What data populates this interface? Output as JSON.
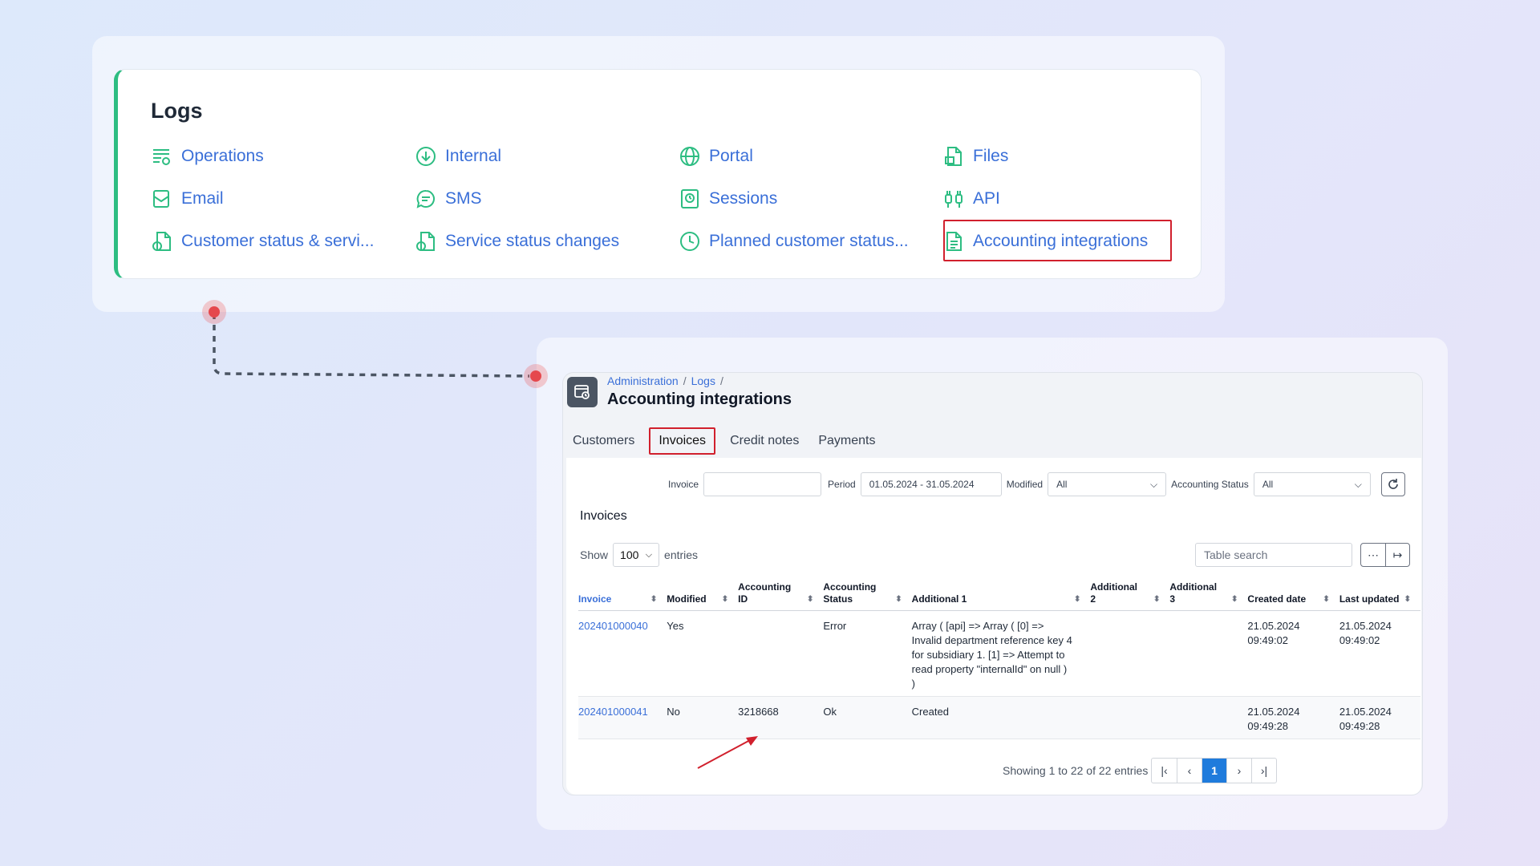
{
  "logs": {
    "title": "Logs",
    "items": [
      {
        "label": "Operations",
        "icon": "operations-icon"
      },
      {
        "label": "Internal",
        "icon": "download-circle-icon"
      },
      {
        "label": "Portal",
        "icon": "globe-icon"
      },
      {
        "label": "Files",
        "icon": "file-icon"
      },
      {
        "label": "Email",
        "icon": "email-icon"
      },
      {
        "label": "SMS",
        "icon": "chat-icon"
      },
      {
        "label": "Sessions",
        "icon": "sessions-icon"
      },
      {
        "label": "API",
        "icon": "api-icon"
      },
      {
        "label": "Customer status & servi...",
        "icon": "status-file-icon"
      },
      {
        "label": "Service status changes",
        "icon": "status-file-icon"
      },
      {
        "label": "Planned customer status...",
        "icon": "clock-icon"
      },
      {
        "label": "Accounting integrations",
        "icon": "document-icon"
      }
    ],
    "accent": "#2dbd82",
    "link_color": "#3a6fd8",
    "highlight_color": "#d1202d"
  },
  "accounting": {
    "breadcrumb": {
      "first": "Administration",
      "sep1": "/",
      "second": "Logs",
      "sep2": "/"
    },
    "title": "Accounting integrations",
    "tabs": [
      "Customers",
      "Invoices",
      "Credit notes",
      "Payments"
    ],
    "active_tab": "Invoices",
    "filters": {
      "invoice_label": "Invoice",
      "invoice_value": "",
      "period_label": "Period",
      "period_value": "01.05.2024 - 31.05.2024",
      "modified_label": "Modified",
      "modified_value": "All",
      "status_label": "Accounting Status",
      "status_value": "All"
    },
    "section_title": "Invoices",
    "show_label": "Show",
    "show_value": "100",
    "entries_label": "entries",
    "search_placeholder": "Table search",
    "columns": [
      "Invoice",
      "Modified",
      "Accounting ID",
      "Accounting Status",
      "Additional 1",
      "Additional 2",
      "Additional 3",
      "Created date",
      "Last updated"
    ],
    "col_lines": [
      [
        "Invoice"
      ],
      [
        "Modified"
      ],
      [
        "Accounting",
        "ID"
      ],
      [
        "Accounting",
        "Status"
      ],
      [
        "Additional 1"
      ],
      [
        "Additional",
        "2"
      ],
      [
        "Additional",
        "3"
      ],
      [
        "Created date"
      ],
      [
        "Last updated"
      ]
    ],
    "rows": [
      {
        "invoice": "202401000040",
        "modified": "Yes",
        "accounting_id": "",
        "status": "Error",
        "additional1": "Array ( [api] => Array ( [0] => Invalid department reference key 4 for subsidiary 1. [1] => Attempt to read property \"internalId\" on null ) )",
        "additional2": "",
        "additional3": "",
        "created": "21.05.2024 09:49:02",
        "updated": "21.05.2024 09:49:02"
      },
      {
        "invoice": "202401000041",
        "modified": "No",
        "accounting_id": "3218668",
        "status": "Ok",
        "additional1": "Created",
        "additional2": "",
        "additional3": "",
        "created": "21.05.2024 09:49:28",
        "updated": "21.05.2024 09:49:28"
      }
    ],
    "pager_info": "Showing 1 to 22 of 22 entries",
    "current_page": "1"
  }
}
